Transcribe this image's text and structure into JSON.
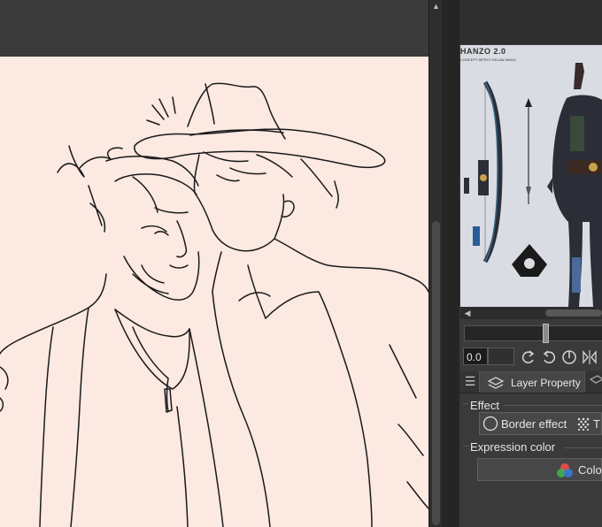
{
  "reference": {
    "title": "HANZO 2.0",
    "subtitle": "CONCEPT ARTIST: KELAN WANG"
  },
  "navigator": {
    "angle_value": "0.0"
  },
  "panel": {
    "tab_label": "Layer Property",
    "effect_label": "Effect",
    "border_effect_label": "Border effect",
    "tone_label": "T",
    "expression_color_label": "Expression color",
    "color_button_label": "Colo"
  },
  "colors": {
    "paper": "#fbe9e2",
    "panel_bg": "#3a3a3a",
    "line_art": "#1a1a1a"
  }
}
